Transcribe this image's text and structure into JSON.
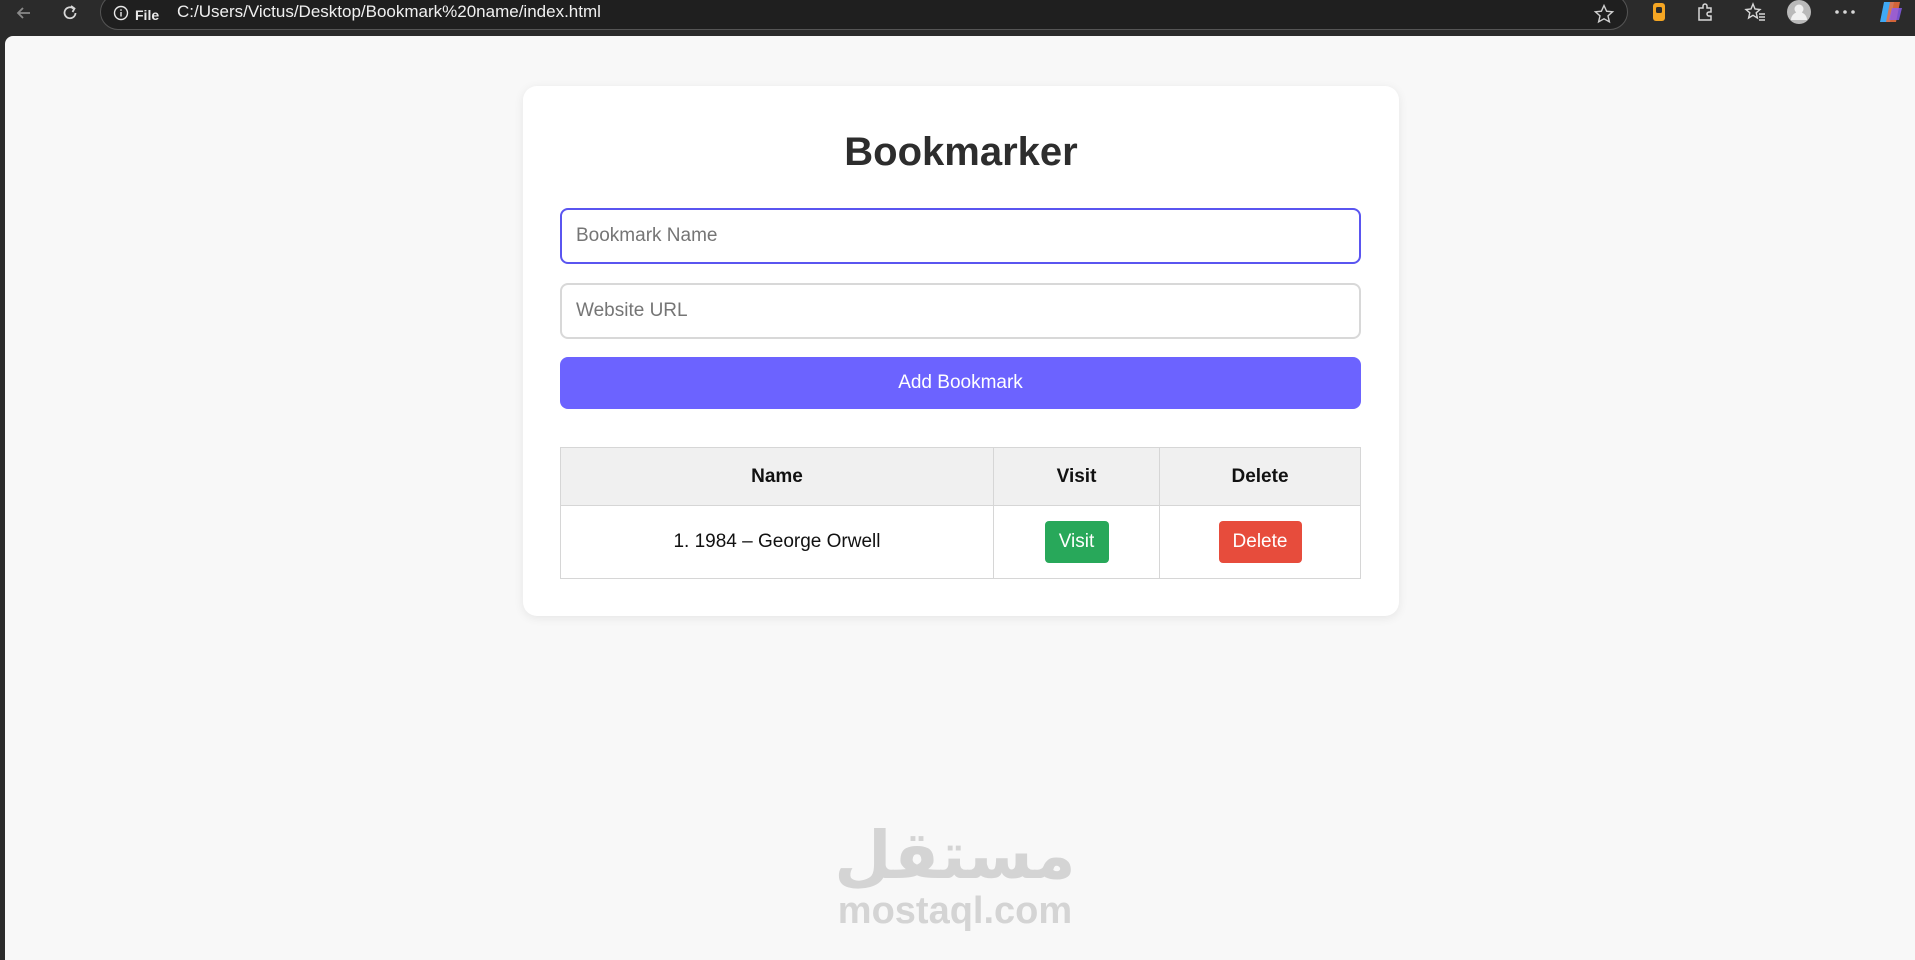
{
  "browser": {
    "address_label": "File",
    "url": "C:/Users/Victus/Desktop/Bookmark%20name/index.html"
  },
  "app": {
    "title": "Bookmarker",
    "name_placeholder": "Bookmark Name",
    "url_placeholder": "Website URL",
    "add_label": "Add Bookmark",
    "accent": "#6c63ff"
  },
  "table": {
    "headers": [
      "Name",
      "Visit",
      "Delete"
    ],
    "rows": [
      {
        "name": "1. 1984 – George Orwell",
        "visit_label": "Visit",
        "delete_label": "Delete"
      }
    ]
  },
  "watermark": {
    "arabic": "مستقل",
    "latin": "mostaql.com"
  }
}
